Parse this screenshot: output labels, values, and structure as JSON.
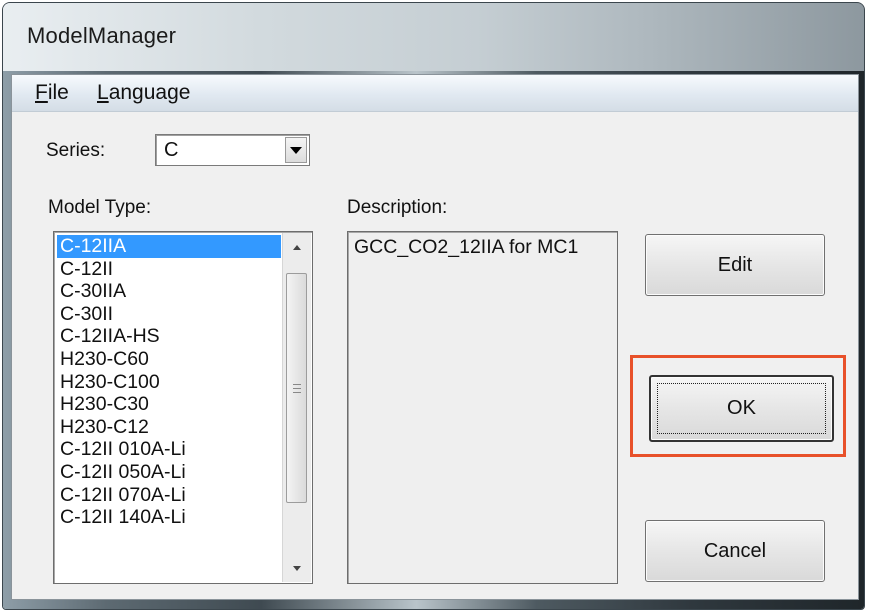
{
  "window": {
    "title": "ModelManager"
  },
  "menu": [
    {
      "mnemonic": "F",
      "rest": "ile"
    },
    {
      "mnemonic": "L",
      "rest": "anguage"
    }
  ],
  "series": {
    "label": "Series:",
    "value": "C"
  },
  "model_type": {
    "label": "Model Type:",
    "items": [
      "C-12IIA",
      "C-12II",
      "C-30IIA",
      "C-30II",
      "C-12IIA-HS",
      "H230-C60",
      "H230-C100",
      "H230-C30",
      "H230-C12",
      "C-12II 010A-Li",
      "C-12II 050A-Li",
      "C-12II 070A-Li",
      "C-12II 140A-Li"
    ],
    "selected_index": 0
  },
  "description": {
    "label": "Description:",
    "text": "GCC_CO2_12IIA for MC1"
  },
  "buttons": {
    "edit": "Edit",
    "ok": "OK",
    "cancel": "Cancel"
  },
  "colors": {
    "selection": "#3399ff",
    "highlight_box": "#e8512a"
  }
}
